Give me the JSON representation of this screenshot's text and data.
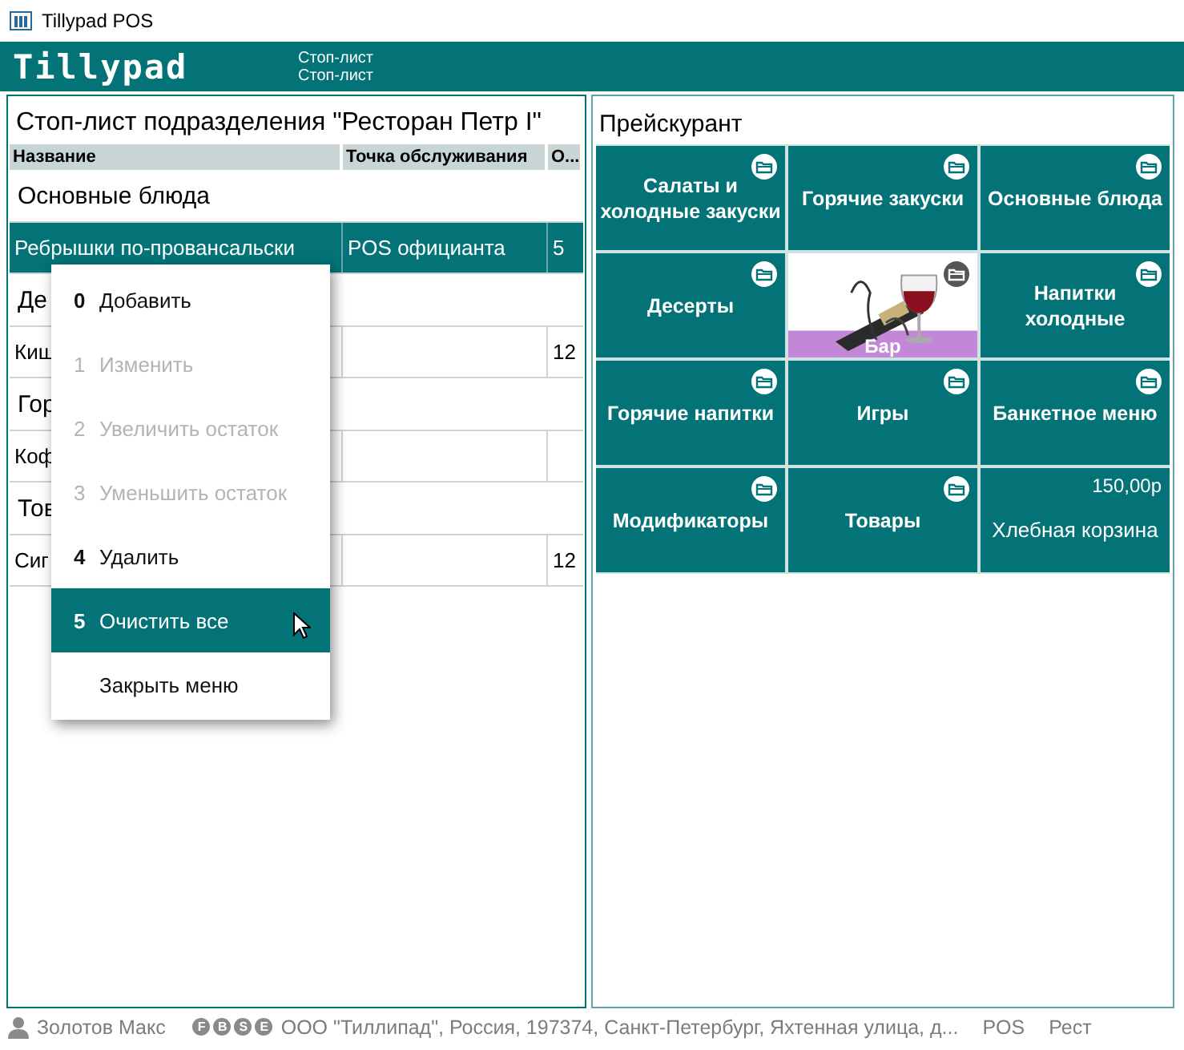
{
  "window": {
    "title": "Tillypad POS"
  },
  "header": {
    "logo": "Tillypad",
    "lines": [
      "Стоп-лист",
      "Стоп-лист"
    ]
  },
  "stop_list": {
    "title": "Стоп-лист подразделения \"Ресторан Петр I\"",
    "columns": [
      "Название",
      "Точка обслуживания",
      "О..."
    ],
    "rows": [
      {
        "kind": "group",
        "name": "Основные блюда"
      },
      {
        "kind": "item",
        "cells": [
          "Ребрышки по-провансальски",
          "POS официанта",
          "5"
        ],
        "selected": true
      },
      {
        "kind": "group",
        "name": "Де"
      },
      {
        "kind": "item",
        "cells": [
          "Киш",
          "",
          "12"
        ],
        "selected": false
      },
      {
        "kind": "group",
        "name": "Гор"
      },
      {
        "kind": "item",
        "cells": [
          "Коф",
          "",
          ""
        ],
        "selected": false
      },
      {
        "kind": "group",
        "name": "Тов"
      },
      {
        "kind": "item",
        "cells": [
          "Сиг",
          "",
          "12"
        ],
        "selected": false
      }
    ]
  },
  "context_menu": {
    "items": [
      {
        "key": "0",
        "label": "Добавить",
        "disabled": false,
        "selected": false
      },
      {
        "key": "1",
        "label": "Изменить",
        "disabled": true,
        "selected": false
      },
      {
        "key": "2",
        "label": "Увеличить остаток",
        "disabled": true,
        "selected": false
      },
      {
        "key": "3",
        "label": "Уменьшить остаток",
        "disabled": true,
        "selected": false
      },
      {
        "key": "4",
        "label": "Удалить",
        "disabled": false,
        "selected": false
      },
      {
        "key": "5",
        "label": "Очистить все",
        "disabled": false,
        "selected": true
      },
      {
        "label": "Закрыть меню",
        "disabled": false,
        "selected": false
      }
    ]
  },
  "price_list": {
    "title": "Прейскурант",
    "tiles": [
      {
        "kind": "folder",
        "label": "Салаты и холодные закуски"
      },
      {
        "kind": "folder",
        "label": "Горячие закуски"
      },
      {
        "kind": "folder",
        "label": "Основные блюда"
      },
      {
        "kind": "folder",
        "label": "Десерты"
      },
      {
        "kind": "picture",
        "label": "Бар"
      },
      {
        "kind": "folder",
        "label": "Напитки холодные"
      },
      {
        "kind": "folder",
        "label": "Горячие напитки"
      },
      {
        "kind": "folder",
        "label": "Игры"
      },
      {
        "kind": "folder",
        "label": "Банкетное меню"
      },
      {
        "kind": "folder",
        "label": "Модификаторы"
      },
      {
        "kind": "folder",
        "label": "Товары"
      },
      {
        "kind": "product",
        "price": "150,00р",
        "label": "Хлебная корзина"
      }
    ]
  },
  "status_bar": {
    "user": "Золотов Макс",
    "badges": [
      "F",
      "B",
      "S",
      "E"
    ],
    "company": "ООО \"Тиллипад\", Россия, 197374, Санкт-Петербург, Яхтенная улица, д...",
    "terminal": "POS",
    "place": "Рест"
  }
}
